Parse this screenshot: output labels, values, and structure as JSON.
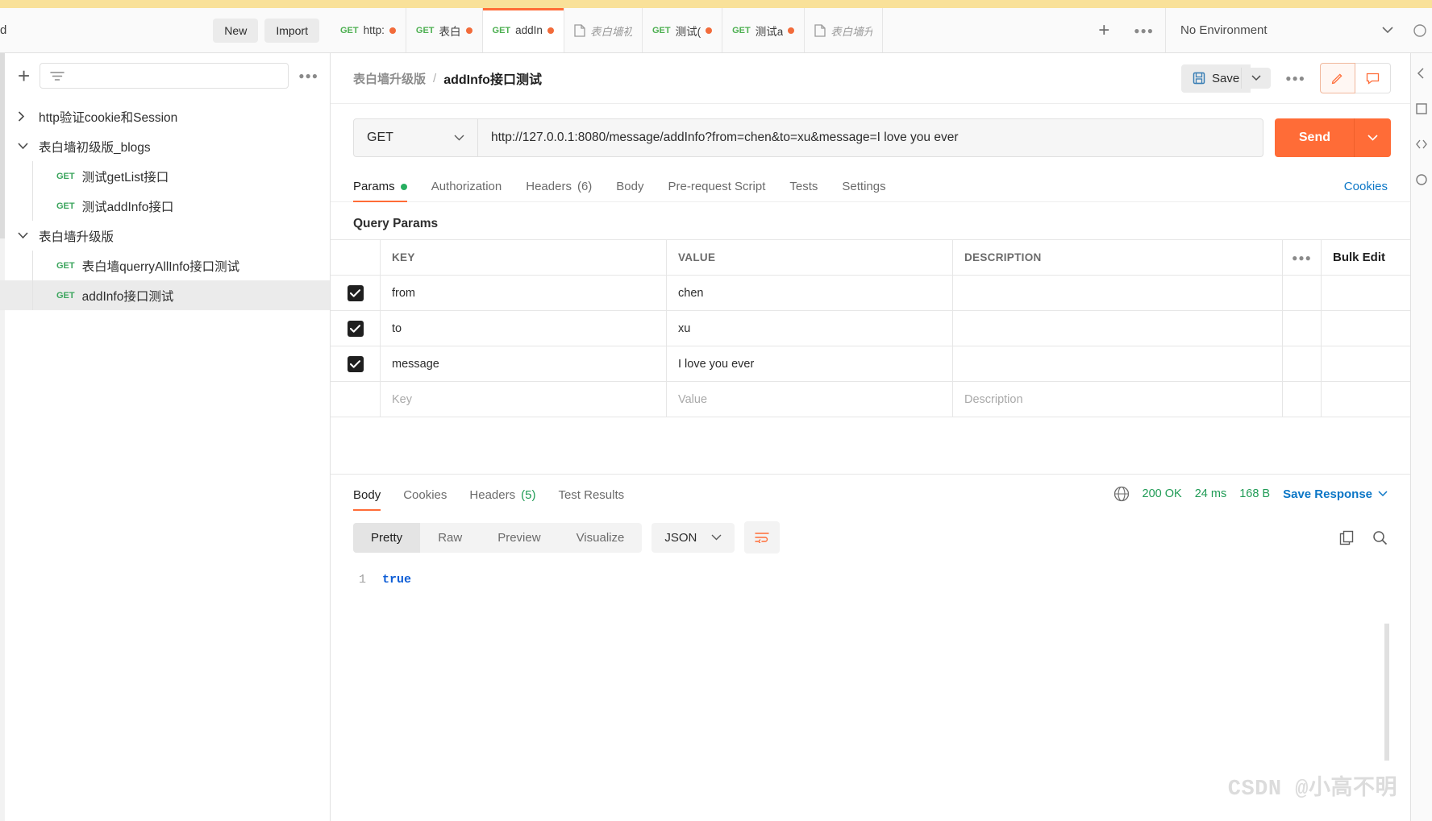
{
  "header": {
    "left_truncated_label": "d",
    "new_button": "New",
    "import_button": "Import",
    "environment_selected": "No Environment",
    "add_tab_icon": "plus-icon",
    "tab_overflow_icon": "more-options-icon"
  },
  "request_tabs": [
    {
      "method": "GET",
      "name": "http:",
      "type": "request",
      "unsaved": true,
      "active": false
    },
    {
      "method": "GET",
      "name": "表白‌",
      "type": "request",
      "unsaved": true,
      "active": false
    },
    {
      "method": "GET",
      "name": "addIn",
      "type": "request",
      "unsaved": true,
      "active": true
    },
    {
      "method": "",
      "name": "表白墙初",
      "type": "document",
      "unsaved": false,
      "active": false
    },
    {
      "method": "GET",
      "name": "测试(",
      "type": "request",
      "unsaved": true,
      "active": false
    },
    {
      "method": "GET",
      "name": "测试a",
      "type": "request",
      "unsaved": true,
      "active": false
    },
    {
      "method": "",
      "name": "表白墙升",
      "type": "document",
      "unsaved": false,
      "active": false
    }
  ],
  "sidebar": {
    "add_icon": "plus-icon",
    "filter_icon": "filter-icon",
    "more_icon": "more-options-icon",
    "tree": [
      {
        "label": "http验证cookie和Session",
        "kind": "collection",
        "expanded": false,
        "method": "",
        "selected": false
      },
      {
        "label": "表白墙初级版_blogs",
        "kind": "collection",
        "expanded": true,
        "method": "",
        "selected": false
      },
      {
        "label": "测试getList接口",
        "kind": "request",
        "expanded": false,
        "method": "GET",
        "selected": false
      },
      {
        "label": "测试addInfo接口",
        "kind": "request",
        "expanded": false,
        "method": "GET",
        "selected": false
      },
      {
        "label": "表白墙升级版",
        "kind": "collection",
        "expanded": true,
        "method": "",
        "selected": false
      },
      {
        "label": "表白墙querryAllInfo接口测试",
        "kind": "request",
        "expanded": false,
        "method": "GET",
        "selected": false
      },
      {
        "label": "addInfo接口测试",
        "kind": "request",
        "expanded": false,
        "method": "GET",
        "selected": true
      }
    ]
  },
  "breadcrumb": {
    "collection": "表白墙升级版",
    "separator": "/",
    "request_name": "addInfo接口测试",
    "save_label": "Save",
    "save_icon": "floppy-disk-icon",
    "save_caret_icon": "chevron-down-icon",
    "more_icon": "more-options-icon",
    "edit_icon": "pencil-icon",
    "comment_icon": "comment-icon"
  },
  "url_bar": {
    "method": "GET",
    "method_caret_icon": "chevron-down-icon",
    "url": "http://127.0.0.1:8080/message/addInfo?from=chen&to=xu&message=I love you ever",
    "send_label": "Send",
    "send_caret_icon": "chevron-down-icon"
  },
  "request_tabs_row": {
    "tabs": [
      {
        "label": "Params",
        "badge": "",
        "dot": true,
        "active": true
      },
      {
        "label": "Authorization",
        "badge": "",
        "dot": false,
        "active": false
      },
      {
        "label": "Headers",
        "badge": "(6)",
        "dot": false,
        "active": false
      },
      {
        "label": "Body",
        "badge": "",
        "dot": false,
        "active": false
      },
      {
        "label": "Pre-request Script",
        "badge": "",
        "dot": false,
        "active": false
      },
      {
        "label": "Tests",
        "badge": "",
        "dot": false,
        "active": false
      },
      {
        "label": "Settings",
        "badge": "",
        "dot": false,
        "active": false
      }
    ],
    "cookies_link": "Cookies"
  },
  "query_params": {
    "title": "Query Params",
    "columns": [
      "KEY",
      "VALUE",
      "DESCRIPTION"
    ],
    "tools_icon": "more-options-icon",
    "bulk_edit_label": "Bulk Edit",
    "rows": [
      {
        "checked": true,
        "key": "from",
        "value": "chen",
        "description": ""
      },
      {
        "checked": true,
        "key": "to",
        "value": "xu",
        "description": ""
      },
      {
        "checked": true,
        "key": "message",
        "value": "I love you ever",
        "description": ""
      }
    ],
    "placeholder_row": {
      "key": "Key",
      "value": "Value",
      "description": "Description"
    }
  },
  "response": {
    "tabs": [
      {
        "label": "Body",
        "badge": "",
        "active": true
      },
      {
        "label": "Cookies",
        "badge": "",
        "active": false
      },
      {
        "label": "Headers",
        "badge": "(5)",
        "active": false
      },
      {
        "label": "Test Results",
        "badge": "",
        "active": false
      }
    ],
    "globe_icon": "globe-icon",
    "status": "200 OK",
    "time": "24 ms",
    "size": "168 B",
    "save_response_label": "Save Response",
    "save_response_caret_icon": "chevron-down-icon",
    "view_modes": [
      {
        "label": "Pretty",
        "active": true
      },
      {
        "label": "Raw",
        "active": false
      },
      {
        "label": "Preview",
        "active": false
      },
      {
        "label": "Visualize",
        "active": false
      }
    ],
    "format": "JSON",
    "format_caret_icon": "chevron-down-icon",
    "wrap_icon": "word-wrap-icon",
    "copy_icon": "copy-icon",
    "search_icon": "search-icon",
    "body_lines": [
      {
        "number": "1",
        "text": "true"
      }
    ]
  },
  "watermark": "CSDN @小高不明",
  "colors": {
    "accent": "#ff6c37",
    "method_get": "#3ba55d",
    "link": "#0b76c6",
    "status_ok": "#1f9b55",
    "top_strip": "#f9e199"
  }
}
